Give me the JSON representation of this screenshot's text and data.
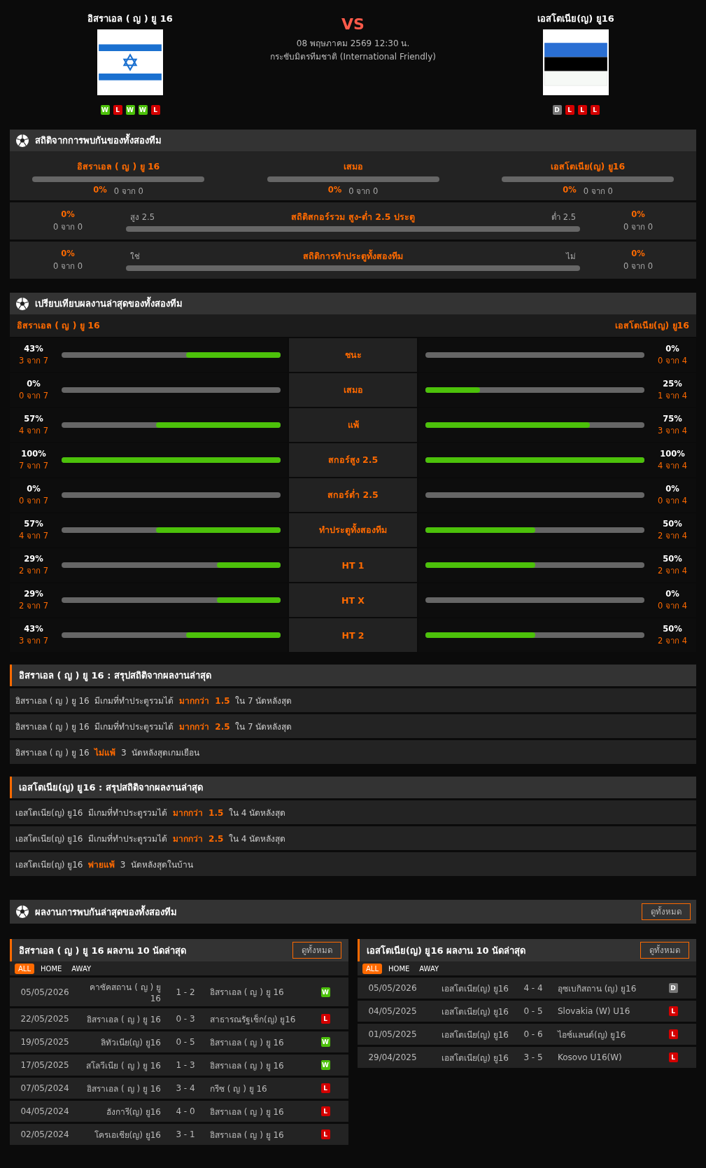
{
  "match": {
    "vs": "VS",
    "date": "08 พฤษภาคม 2569 12:30 น.",
    "competition": "กระชับมิตรทีมชาติ (International Friendly)",
    "home": {
      "name": "อิสราเอล ( ญ ) ยู 16",
      "form": [
        {
          "label": "W",
          "kind": "win"
        },
        {
          "label": "L",
          "kind": "loss"
        },
        {
          "label": "W",
          "kind": "win"
        },
        {
          "label": "W",
          "kind": "win"
        },
        {
          "label": "L",
          "kind": "loss"
        }
      ]
    },
    "away": {
      "name": "เอสโตเนีย(ญ) ยู16",
      "form": [
        {
          "label": "D",
          "kind": "draw"
        },
        {
          "label": "L",
          "kind": "loss"
        },
        {
          "label": "L",
          "kind": "loss"
        },
        {
          "label": "L",
          "kind": "loss"
        }
      ]
    }
  },
  "h2h": {
    "title": "สถิติจากการพบกันของทั้งสองทีม",
    "outcomes": [
      {
        "label": "อิสราเอล ( ญ ) ยู 16",
        "pct": "0%",
        "count": "0 จาก 0",
        "level": 0
      },
      {
        "label": "เสมอ",
        "pct": "0%",
        "count": "0 จาก 0",
        "level": 0
      },
      {
        "label": "เอสโตเนีย(ญ) ยู16",
        "pct": "0%",
        "count": "0 จาก 0",
        "level": 0
      }
    ],
    "goal_stats": [
      {
        "title": "สถิติสกอร์รวม สูง-ต่ำ 2.5 ประตู",
        "left_label": "สูง 2.5",
        "right_label": "ต่ำ 2.5",
        "left_pct": "0%",
        "left_count": "0 จาก 0",
        "right_pct": "0%",
        "right_count": "0 จาก 0",
        "level": 0
      },
      {
        "title": "สถิติการทำประตูทั้งสองทีม",
        "left_label": "ใช่",
        "right_label": "ไม่",
        "left_pct": "0%",
        "left_count": "0 จาก 0",
        "right_pct": "0%",
        "right_count": "0 จาก 0",
        "level": 0
      }
    ]
  },
  "comparison": {
    "title": "เปรียบเทียบผลงานล่าสุดของทั้งสองทีม",
    "home_team": "อิสราเอล ( ญ ) ยู 16",
    "away_team": "เอสโตเนีย(ญ) ยู16",
    "rows": [
      {
        "label": "ชนะ",
        "home": {
          "pct": "43%",
          "count": "3 จาก 7",
          "level": 0.43
        },
        "away": {
          "pct": "0%",
          "count": "0 จาก 4",
          "level": 0
        }
      },
      {
        "label": "เสมอ",
        "home": {
          "pct": "0%",
          "count": "0 จาก 7",
          "level": 0
        },
        "away": {
          "pct": "25%",
          "count": "1 จาก 4",
          "level": 0.25
        }
      },
      {
        "label": "แพ้",
        "home": {
          "pct": "57%",
          "count": "4 จาก 7",
          "level": 0.57
        },
        "away": {
          "pct": "75%",
          "count": "3 จาก 4",
          "level": 0.75
        }
      },
      {
        "label": "สกอร์สูง 2.5",
        "home": {
          "pct": "100%",
          "count": "7 จาก 7",
          "level": 1
        },
        "away": {
          "pct": "100%",
          "count": "4 จาก 4",
          "level": 1
        }
      },
      {
        "label": "สกอร์ต่ำ 2.5",
        "home": {
          "pct": "0%",
          "count": "0 จาก 7",
          "level": 0
        },
        "away": {
          "pct": "0%",
          "count": "0 จาก 4",
          "level": 0
        }
      },
      {
        "label": "ทำประตูทั้งสองทีม",
        "home": {
          "pct": "57%",
          "count": "4 จาก 7",
          "level": 0.57
        },
        "away": {
          "pct": "50%",
          "count": "2 จาก 4",
          "level": 0.5
        }
      },
      {
        "label": "HT 1",
        "home": {
          "pct": "29%",
          "count": "2 จาก 7",
          "level": 0.29
        },
        "away": {
          "pct": "50%",
          "count": "2 จาก 4",
          "level": 0.5
        }
      },
      {
        "label": "HT X",
        "home": {
          "pct": "29%",
          "count": "2 จาก 7",
          "level": 0.29
        },
        "away": {
          "pct": "0%",
          "count": "0 จาก 4",
          "level": 0
        }
      },
      {
        "label": "HT 2",
        "home": {
          "pct": "43%",
          "count": "3 จาก 7",
          "level": 0.43
        },
        "away": {
          "pct": "50%",
          "count": "2 จาก 4",
          "level": 0.5
        }
      }
    ]
  },
  "summaries": [
    {
      "title": "อิสราเอล ( ญ ) ยู 16 : สรุปสถิติจากผลงานล่าสุด",
      "lines": [
        "อิสราเอล ( ญ ) ยู 16  มีเกมที่ทำประตูรวมได้  **มากกว่า  1.5**  ใน 7 นัดหลังสุด",
        "อิสราเอล ( ญ ) ยู 16  มีเกมที่ทำประตูรวมได้  **มากกว่า  2.5**  ใน 7 นัดหลังสุด",
        "อิสราเอล ( ญ ) ยู 16  **ไม่แพ้**  3  นัดหลังสุดเกมเยือน"
      ]
    },
    {
      "title": "เอสโตเนีย(ญ) ยู16 : สรุปสถิติจากผลงานล่าสุด",
      "lines": [
        "เอสโตเนีย(ญ) ยู16  มีเกมที่ทำประตูรวมได้  **มากกว่า  1.5**  ใน 4 นัดหลังสุด",
        "เอสโตเนีย(ญ) ยู16  มีเกมที่ทำประตูรวมได้  **มากกว่า  2.5**  ใน 4 นัดหลังสุด",
        "เอสโตเนีย(ญ) ยู16  **พ่ายแพ้**  3  นัดหลังสุดในบ้าน"
      ]
    }
  ],
  "results": {
    "title": "ผลงานการพบกันล่าสุดของทั้งสองทีม",
    "button": "ดูทั้งหมด"
  },
  "recent": [
    {
      "title": "อิสราเอล ( ญ ) ยู 16 ผลงาน 10 นัดล่าสุด",
      "button": "ดูทั้งหมด",
      "filters": [
        {
          "label": "ALL",
          "selected": true
        },
        {
          "label": "HOME",
          "selected": false
        },
        {
          "label": "AWAY",
          "selected": false
        }
      ],
      "matches": [
        {
          "date": "05/05/2026",
          "home": "คาซัคสถาน ( ญ ) ยู 16",
          "score": "1 - 2",
          "away": "อิสราเอล ( ญ ) ยู 16",
          "result": {
            "label": "W",
            "kind": "win"
          }
        },
        {
          "date": "22/05/2025",
          "home": "อิสราเอล ( ญ ) ยู 16",
          "score": "0 - 3",
          "away": "สาธารณรัฐเช็ก(ญ) ยู16",
          "result": {
            "label": "L",
            "kind": "loss"
          }
        },
        {
          "date": "19/05/2025",
          "home": "ลิทัวเนีย(ญ) ยู16",
          "score": "0 - 5",
          "away": "อิสราเอล ( ญ ) ยู 16",
          "result": {
            "label": "W",
            "kind": "win"
          }
        },
        {
          "date": "17/05/2025",
          "home": "สโลวีเนีย ( ญ ) ยู 16",
          "score": "1 - 3",
          "away": "อิสราเอล ( ญ ) ยู 16",
          "result": {
            "label": "W",
            "kind": "win"
          }
        },
        {
          "date": "07/05/2024",
          "home": "อิสราเอล ( ญ ) ยู 16",
          "score": "3 - 4",
          "away": "กรีซ ( ญ ) ยู 16",
          "result": {
            "label": "L",
            "kind": "loss"
          }
        },
        {
          "date": "04/05/2024",
          "home": "ฮังการี(ญ) ยู16",
          "score": "4 - 0",
          "away": "อิสราเอล ( ญ ) ยู 16",
          "result": {
            "label": "L",
            "kind": "loss"
          }
        },
        {
          "date": "02/05/2024",
          "home": "โครเอเชีย(ญ) ยู16",
          "score": "3 - 1",
          "away": "อิสราเอล ( ญ ) ยู 16",
          "result": {
            "label": "L",
            "kind": "loss"
          }
        }
      ]
    },
    {
      "title": "เอสโตเนีย(ญ) ยู16 ผลงาน 10 นัดล่าสุด",
      "button": "ดูทั้งหมด",
      "filters": [
        {
          "label": "ALL",
          "selected": true
        },
        {
          "label": "HOME",
          "selected": false
        },
        {
          "label": "AWAY",
          "selected": false
        }
      ],
      "matches": [
        {
          "date": "05/05/2026",
          "home": "เอสโตเนีย(ญ) ยู16",
          "score": "4 - 4",
          "away": "อุซเบกิสถาน (ญ) ยู16",
          "result": {
            "label": "D",
            "kind": "draw"
          }
        },
        {
          "date": "04/05/2025",
          "home": "เอสโตเนีย(ญ) ยู16",
          "score": "0 - 5",
          "away": "Slovakia (W) U16",
          "result": {
            "label": "L",
            "kind": "loss"
          }
        },
        {
          "date": "01/05/2025",
          "home": "เอสโตเนีย(ญ) ยู16",
          "score": "0 - 6",
          "away": "ไอซ์แลนด์(ญ) ยู16",
          "result": {
            "label": "L",
            "kind": "loss"
          }
        },
        {
          "date": "29/04/2025",
          "home": "เอสโตเนีย(ญ) ยู16",
          "score": "3 - 5",
          "away": "Kosovo U16(W)",
          "result": {
            "label": "L",
            "kind": "loss"
          }
        }
      ]
    }
  ]
}
